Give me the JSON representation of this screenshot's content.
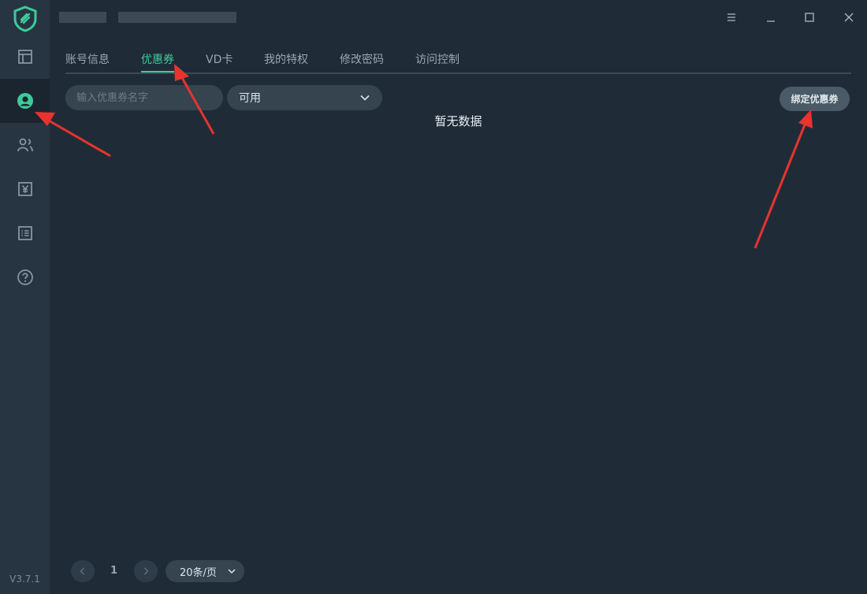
{
  "app": {
    "version": "V3.7.1",
    "accent_color": "#3dcb9a"
  },
  "sidebar": {
    "items": [
      {
        "icon": "layout-icon"
      },
      {
        "icon": "user-circle-icon",
        "active": true
      },
      {
        "icon": "users-icon"
      },
      {
        "icon": "yen-icon"
      },
      {
        "icon": "list-icon"
      },
      {
        "icon": "help-icon"
      }
    ]
  },
  "titlebar": {
    "buttons": [
      "menu-icon",
      "minimize-icon",
      "maximize-icon",
      "close-icon"
    ]
  },
  "tabs": [
    {
      "label": "账号信息"
    },
    {
      "label": "优惠券",
      "active": true
    },
    {
      "label": "VD卡"
    },
    {
      "label": "我的特权"
    },
    {
      "label": "修改密码"
    },
    {
      "label": "访问控制"
    }
  ],
  "filters": {
    "search_placeholder": "输入优惠券名字",
    "status_value": "可用"
  },
  "actions": {
    "bind_label": "绑定优惠券"
  },
  "empty_text": "暂无数据",
  "pagination": {
    "current_page": "1",
    "page_size": "20条/页"
  }
}
